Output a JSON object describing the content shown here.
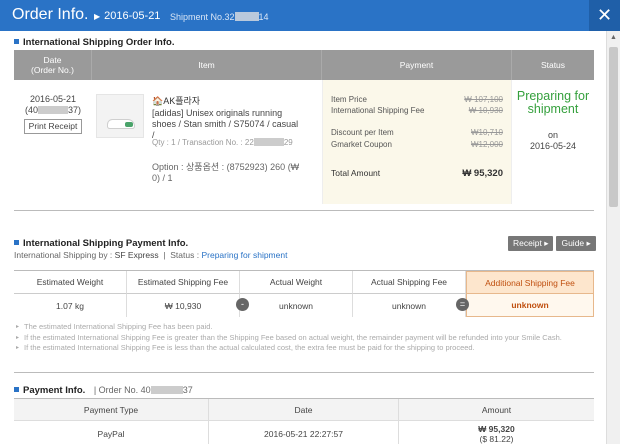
{
  "header": {
    "title": "Order Info.",
    "date": "2016-05-21",
    "shipment_label": "Shipment No.32",
    "shipment_suffix": "14",
    "close_icon": "close-icon"
  },
  "order_section": {
    "title": "International Shipping Order Info.",
    "columns": [
      "Date\n(Order No.)",
      "Item",
      "Payment",
      "Status"
    ],
    "date": "2016-05-21",
    "order_no_prefix": "(40",
    "order_no_suffix": "37)",
    "print_receipt": "Print Receipt",
    "store": "AK플라자",
    "product_name": "[adidas] Unisex originals running shoes / Stan smith / S75074 / casual /",
    "qty_label": "Qty : 1 / Transaction No. : 22",
    "qty_suffix": "29",
    "option": "Option : 상품옵션 : (8752923) 260 (₩ 0) / 1",
    "payment": {
      "item_price_label": "Item Price",
      "item_price": "₩ 107,100",
      "intl_fee_label": "International Shipping Fee",
      "intl_fee": "₩ 10,930",
      "discount_label": "Discount per Item",
      "discount": "₩10,710",
      "coupon_label": "Gmarket Coupon",
      "coupon": "₩12,000",
      "total_label": "Total Amount",
      "total": "₩ 95,320"
    },
    "status": "Preparing for shipment",
    "status_on_label": "on",
    "status_date": "2016-05-24"
  },
  "shipping_payment": {
    "title": "International Shipping Payment Info.",
    "by_label": "International Shipping by :",
    "carrier": "SF Express",
    "status_label": "Status :",
    "status": "Preparing for shipment",
    "receipt_button": "Receipt",
    "guide_button": "Guide",
    "columns": [
      "Estimated Weight",
      "Estimated Shipping Fee",
      "Actual Weight",
      "Actual Shipping Fee",
      "Additional Shipping Fee"
    ],
    "values": [
      "1.07 kg",
      "₩ 10,930",
      "unknown",
      "unknown",
      "unknown"
    ],
    "notes": [
      "The estimated International Shipping Fee has been paid.",
      "If the estimated International Shipping Fee is greater than the Shipping Fee based on actual weight, the remainder payment will be refunded into your Smile Cash.",
      "If the estimated International Shipping Fee is less than the actual calculated cost, the extra fee must be paid for the shipping to proceed."
    ]
  },
  "payment_info": {
    "title": "Payment Info.",
    "order_label": "Order No. 40",
    "order_suffix": "37",
    "columns": [
      "Payment Type",
      "Date",
      "Amount"
    ],
    "type": "PayPal",
    "date": "2016-05-21 22:27:57",
    "amount": "₩ 95,320",
    "amount_usd": "($ 81.22)"
  }
}
